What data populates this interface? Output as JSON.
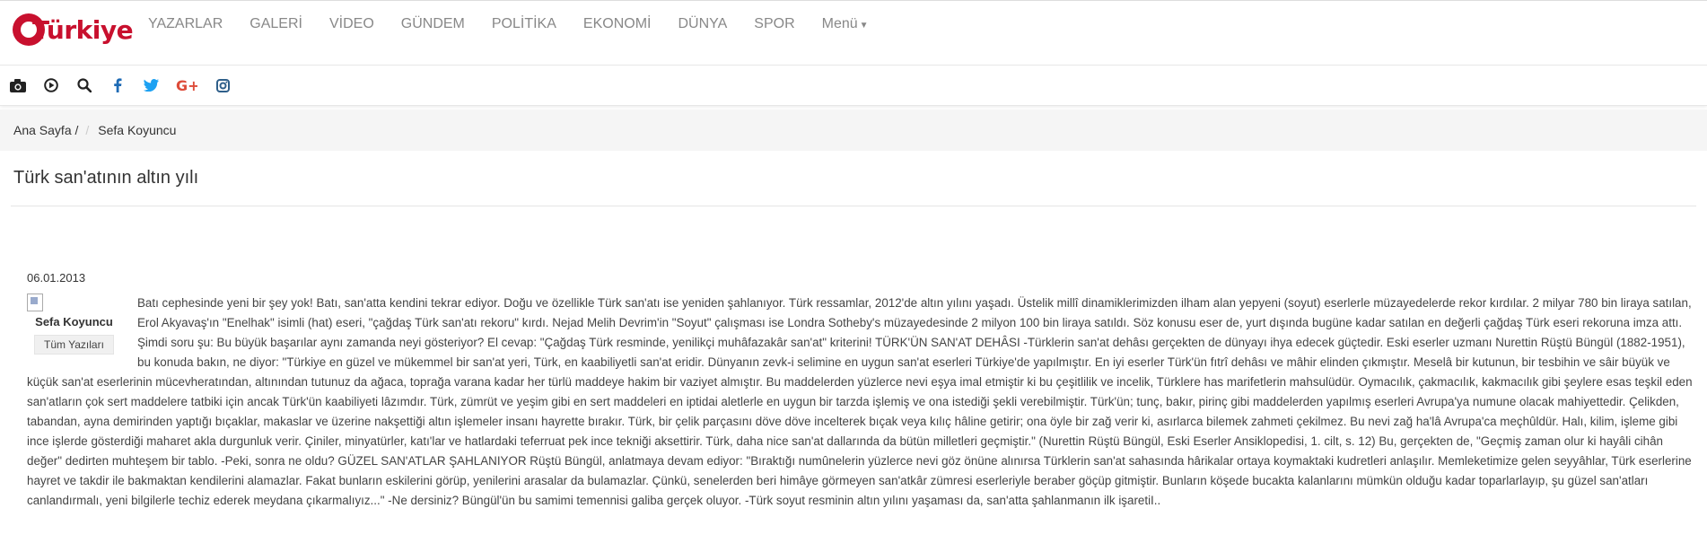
{
  "site": {
    "logo_text": "Türkiye",
    "nav": [
      "YAZARLAR",
      "GALERİ",
      "VİDEO",
      "GÜNDEM",
      "POLİTİKA",
      "EKONOMİ",
      "DÜNYA",
      "SPOR",
      "Menü"
    ],
    "icons": [
      "camera-icon",
      "play-icon",
      "search-icon",
      "facebook-icon",
      "twitter-icon",
      "google-plus-icon",
      "instagram-icon"
    ]
  },
  "breadcrumb": {
    "home": "Ana Sayfa /",
    "current": "Sefa Koyuncu"
  },
  "article": {
    "title": "Türk san'atının altın yılı",
    "date": "06.01.2013",
    "author": {
      "name": "Sefa Koyuncu",
      "all_posts": "Tüm Yazıları"
    },
    "body": "Batı cephesinde yeni bir şey yok! Batı, san'atta kendini tekrar ediyor. Doğu ve özellikle Türk san'atı ise yeniden şahlanıyor. Türk ressamlar, 2012'de altın yılını yaşadı. Üstelik millî dinamiklerimizden ilham alan yepyeni (soyut) eserlerle müzayedelerde rekor kırdılar. 2 milyar 780 bin liraya satılan, Erol Akyavaş'ın \"Enelhak\" isimli (hat) eseri, \"çağdaş Türk san'atı rekoru\" kırdı. Nejad Melih Devrim'in \"Soyut\" çalışması ise Londra Sotheby's müzayedesinde 2 milyon 100 bin liraya satıldı. Söz konusu eser de, yurt dışında bugüne kadar satılan en değerli çağdaş Türk eseri rekoruna imza attı. Şimdi soru şu: Bu büyük başarılar aynı zamanda neyi gösteriyor? El cevap: \"Çağdaş Türk resminde, yenilikçi muhâfazakâr san'at\" kriterini! TÜRK'ÜN SAN'AT DEHÂSI -Türklerin san'at dehâsı gerçekten de dünyayı ihya edecek güçtedir. Eski eserler uzmanı Nurettin Rüştü Büngül (1882-1951), bu konuda bakın, ne diyor: \"Türkiye en güzel ve mükemmel bir san'at yeri, Türk, en kaabiliyetli san'at eridir. Dünyanın zevk-i selimine en uygun san'at eserleri Türkiye'de yapılmıştır. En iyi eserler Türk'ün fıtrî dehâsı ve mâhir elinden çıkmıştır. Meselâ bir kutunun, bir tesbihin ve sâir büyük ve küçük san'at eserlerinin mücevheratından, altınından tutunuz da ağaca, toprağa varana kadar her türlü maddeye hakim bir vaziyet almıştır. Bu maddelerden yüzlerce nevi eşya imal etmiştir ki bu çeşitlilik ve incelik, Türklere has marifetlerin mahsulüdür. Oymacılık, çakmacılık, kakmacılık gibi şeylere esas teşkil eden san'atların çok sert maddelere tatbiki için ancak Türk'ün kaabiliyeti lâzımdır. Türk, zümrüt ve yeşim gibi en sert maddeleri en iptidai aletlerle en uygun bir tarzda işlemiş ve ona istediği şekli verebilmiştir. Türk'ün; tunç, bakır, pirinç gibi maddelerden yapılmış eserleri Avrupa'ya numune olacak mahiyettedir. Çelikden, tabandan, ayna demirinden yaptığı bıçaklar, makaslar ve üzerine nakşettiği altın işlemeler insanı hayrette bırakır. Türk, bir çelik parçasını döve döve incelterek bıçak veya kılıç hâline getirir; ona öyle bir zağ verir ki, asırlarca bilemek zahmeti çekilmez. Bu nevi zağ ha'lâ Avrupa'ca meçhûldür. Halı, kilim, işleme gibi ince işlerde gösterdiği maharet akla durgunluk verir. Çiniler, minyatürler, katı'lar ve hatlardaki teferruat pek ince tekniği aksettirir. Türk, daha nice san'at dallarında da bütün milletleri geçmiştir.\" (Nurettin Rüştü Büngül, Eski Eserler Ansiklopedisi, 1. cilt, s. 12) Bu, gerçekten de, \"Geçmiş zaman olur ki hayâli cihân değer\" dedirten muhteşem bir tablo. -Peki, sonra ne oldu? GÜZEL SAN'ATLAR ŞAHLANIYOR Rüştü Büngül, anlatmaya devam ediyor: \"Bıraktığı numûnelerin yüzlerce nevi göz önüne alınırsa Türklerin san'at sahasında hârikalar ortaya koymaktaki kudretleri anlaşılır. Memleketimize gelen seyyâhlar, Türk eserlerine hayret ve takdir ile bakmaktan kendilerini alamazlar. Fakat bunların eskilerini görüp, yenilerini arasalar da bulamazlar. Çünkü, senelerden beri himâye görmeyen san'atkâr zümresi eserleriyle beraber göçüp gitmiştir. Bunların köşede bucakta kalanlarını mümkün olduğu kadar toparlarlayıp, şu güzel san'atları canlandırmalı, yeni bilgilerle techiz ederek meydana çıkarmalıyız...\" -Ne dersiniz? Büngül'ün bu samimi temennisi galiba gerçek oluyor. -Türk soyut resminin altın yılını yaşaması da, san'atta şahlanmanın ilk işaretiI.."
  }
}
